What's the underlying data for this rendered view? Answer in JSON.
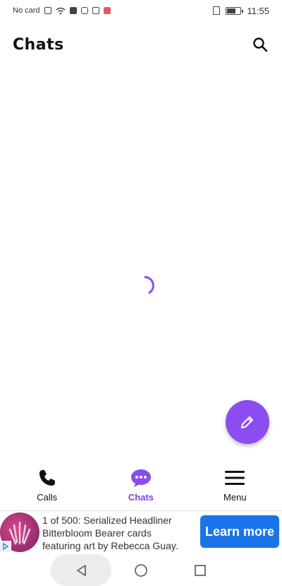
{
  "status_bar": {
    "carrier": "No card",
    "time": "11:55",
    "battery_level": 0.6
  },
  "header": {
    "title": "Chats"
  },
  "bottom_nav": {
    "items": [
      {
        "label": "Calls",
        "icon": "phone-icon"
      },
      {
        "label": "Chats",
        "icon": "chat-bubble-icon",
        "active": true
      },
      {
        "label": "Menu",
        "icon": "hamburger-menu-icon"
      }
    ]
  },
  "ad": {
    "line1": "1 of 500: Serialized Headliner",
    "line2": "Bitterbloom Bearer cards",
    "line3": "featuring art by Rebecca Guay.",
    "cta": "Learn more"
  },
  "colors": {
    "accent": "#8b4cf0",
    "active_nav": "#7b45e0",
    "cta": "#1a73e8"
  }
}
